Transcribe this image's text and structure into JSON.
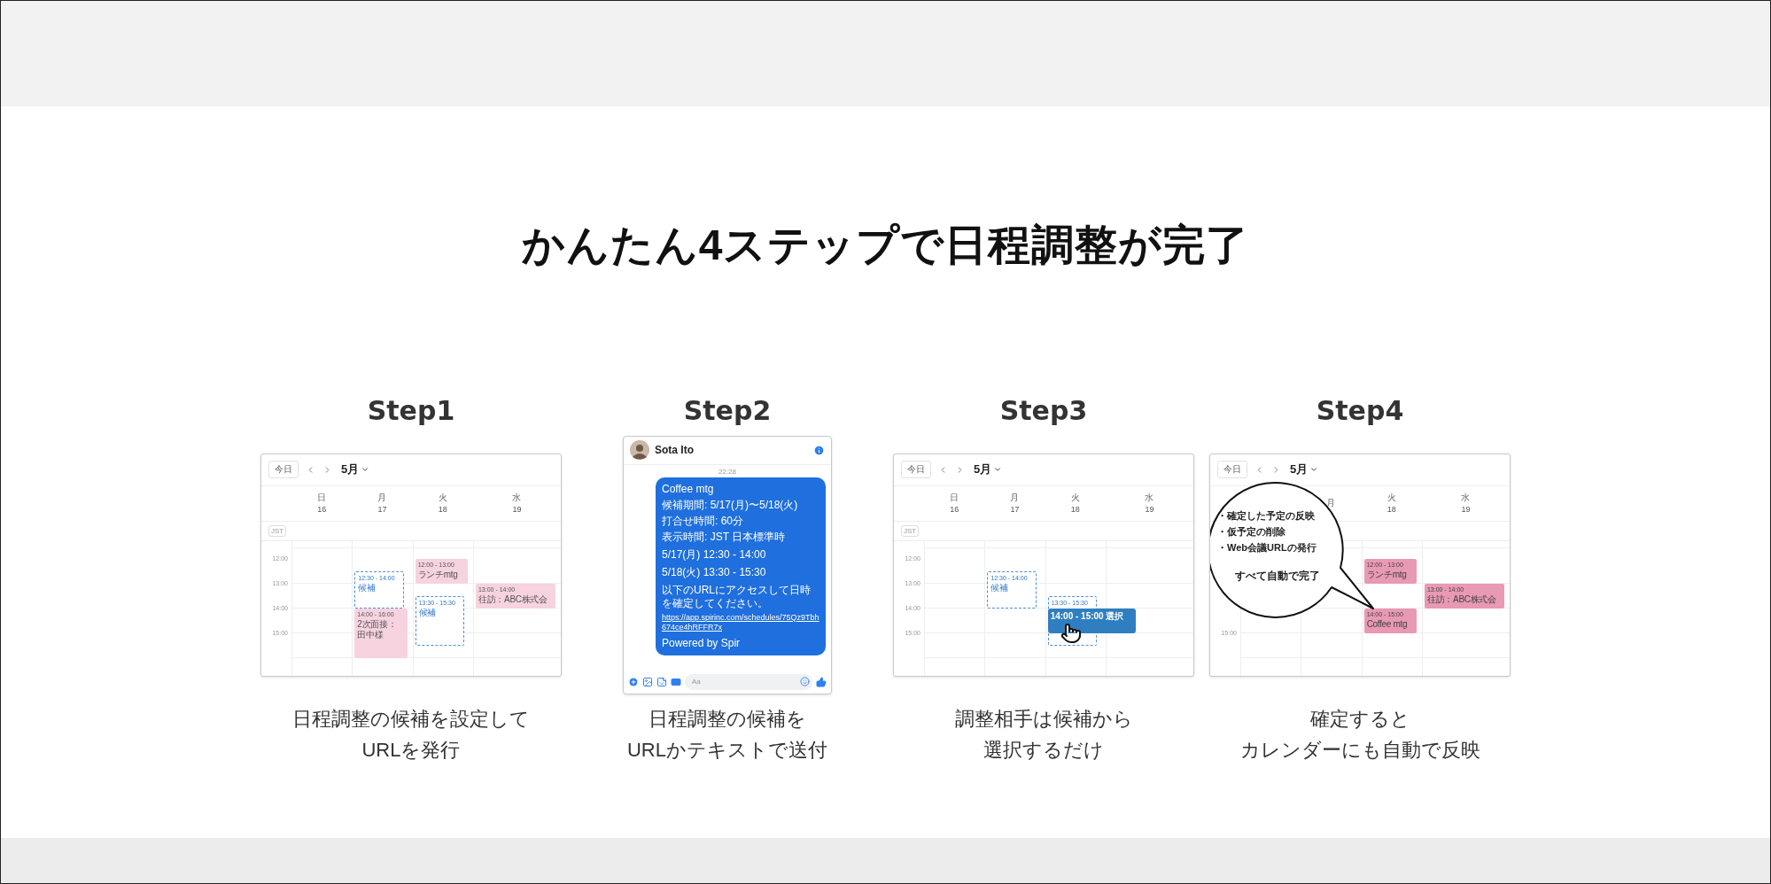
{
  "page": {
    "title": "かんたん4ステップで日程調整が完了"
  },
  "steps": [
    {
      "label": "Step1",
      "screen": {
        "kind": "calendar",
        "today_button": "今日",
        "month": "5月",
        "timezone": "JST",
        "days": [
          {
            "weekday": "日",
            "date": "16"
          },
          {
            "weekday": "月",
            "date": "17",
            "events": [
              {
                "kind": "candidate",
                "time": "12:30 - 14:00",
                "title": "候補"
              },
              {
                "kind": "busy",
                "time": "14:00 - 16:00",
                "title": "2次面接：田中様"
              }
            ]
          },
          {
            "weekday": "火",
            "date": "18",
            "events": [
              {
                "kind": "busy",
                "time": "12:00 - 13:00",
                "title": "ランチmtg"
              },
              {
                "kind": "candidate",
                "time": "13:30 - 15:30",
                "title": "候補"
              }
            ]
          },
          {
            "weekday": "水",
            "date": "19",
            "events": [
              {
                "kind": "busy",
                "time": "13:00 - 14:00",
                "title": "往訪：ABC株式会"
              }
            ]
          }
        ],
        "hours": [
          {
            "label": "12:00"
          },
          {
            "label": "13:00"
          },
          {
            "label": "14:00"
          },
          {
            "label": "15:00"
          }
        ]
      },
      "caption": [
        "日程調整の候補を設定して",
        "URLを発行"
      ]
    },
    {
      "label": "Step2",
      "screen": {
        "kind": "chat",
        "contact": "Sota Ito",
        "timestamp": "22:28",
        "message": [
          {
            "lines": [
              "Coffee mtg",
              "候補期間: 5/17(月)〜5/18(火)",
              "打合せ時間: 60分",
              "表示時間: JST 日本標準時"
            ]
          },
          {
            "lines": [
              "5/17(月) 12:30 - 14:00"
            ]
          },
          {
            "lines": [
              "5/18(火) 13:30 - 15:30"
            ]
          },
          {
            "lines": [
              "以下のURLにアクセスして日時を確定してください。"
            ],
            "link": "https://app.spirinc.com/schedules/75Qz9Tbh674ce4hRFFR7x"
          },
          {
            "lines": [
              "Powered by Spir"
            ]
          }
        ],
        "composer": {
          "placeholder": "Aa"
        }
      },
      "caption": [
        "日程調整の候補を",
        "URLかテキストで送付"
      ]
    },
    {
      "label": "Step3",
      "screen": {
        "kind": "calendar",
        "today_button": "今日",
        "month": "5月",
        "timezone": "JST",
        "days": [
          {
            "weekday": "日",
            "date": "16"
          },
          {
            "weekday": "月",
            "date": "17",
            "events": [
              {
                "kind": "candidate",
                "time": "12:30 - 14:00",
                "title": "候補"
              }
            ]
          },
          {
            "weekday": "火",
            "date": "18",
            "events": [
              {
                "kind": "candidate",
                "time": "13:30 - 15:30"
              },
              {
                "kind": "selected",
                "time": "14:00 - 15:00 選択",
                "cursor": true
              }
            ]
          },
          {
            "weekday": "水",
            "date": "19"
          }
        ],
        "hours": [
          {
            "label": "12:00"
          },
          {
            "label": "13:00"
          },
          {
            "label": "14:00"
          },
          {
            "label": "15:00"
          }
        ]
      },
      "caption": [
        "調整相手は候補から",
        "選択するだけ"
      ]
    },
    {
      "label": "Step4",
      "screen": {
        "kind": "calendar",
        "today_button": "今日",
        "month": "5月",
        "days": [
          {
            "weekday": "月"
          },
          {
            "weekday": "火",
            "date": "18",
            "events": [
              {
                "kind": "confirmed",
                "time": "12:00 - 13:00",
                "title": "ランチmtg"
              },
              {
                "kind": "confirmed",
                "time": "14:00 - 15:00",
                "title": "Coffee mtg"
              }
            ]
          },
          {
            "weekday": "水",
            "date": "19",
            "events": [
              {
                "kind": "confirmed",
                "time": "13:00 - 14:00",
                "title": "往訪：ABC株式会"
              }
            ]
          }
        ],
        "hours": [
          {
            "label": "15:00"
          }
        ],
        "callout": {
          "items": [
            "・確定した予定の反映",
            "・仮予定の削除",
            "・Web会議URLの発行"
          ],
          "footer": "すべて自動で完了"
        }
      },
      "caption": [
        "確定すると",
        "カレンダーにも自動で反映"
      ]
    }
  ]
}
